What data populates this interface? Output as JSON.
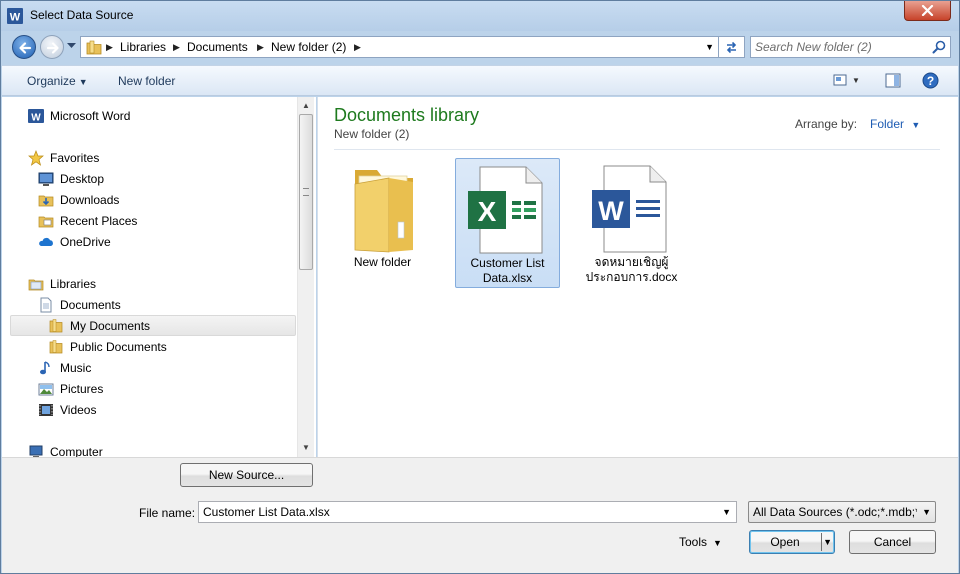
{
  "window": {
    "title": "Select Data Source",
    "app_icon": "word-icon",
    "close_icon": "close-icon"
  },
  "address_bar": {
    "crumbs": [
      "Libraries",
      "Documents",
      "New folder (2)"
    ],
    "search_placeholder": "Search New folder (2)"
  },
  "toolbar": {
    "organize_label": "Organize",
    "new_folder_label": "New folder"
  },
  "nav": {
    "app": "Microsoft Word",
    "favorites_header": "Favorites",
    "favorites": [
      "Desktop",
      "Downloads",
      "Recent Places",
      "OneDrive"
    ],
    "libraries_header": "Libraries",
    "documents": "Documents",
    "my_documents": "My Documents",
    "public_documents": "Public Documents",
    "music": "Music",
    "pictures": "Pictures",
    "videos": "Videos",
    "computer": "Computer"
  },
  "content": {
    "library_title": "Documents library",
    "library_subtitle": "New folder (2)",
    "arrange_label": "Arrange by:",
    "arrange_value": "Folder",
    "files": [
      {
        "name": "New folder",
        "type": "folder"
      },
      {
        "name_line1": "Customer List",
        "name_line2": "Data.xlsx",
        "type": "excel",
        "selected": true
      },
      {
        "name_line1": "จดหมายเชิญผู้",
        "name_line2": "ประกอบการ.docx",
        "type": "word"
      }
    ]
  },
  "footer": {
    "new_source_label": "New Source...",
    "file_name_label": "File name:",
    "file_name_value": "Customer List Data.xlsx",
    "filter_value": "All Data Sources (*.odc;*.mdb;*",
    "tools_label": "Tools",
    "open_label": "Open",
    "cancel_label": "Cancel"
  },
  "colors": {
    "library_title": "#1e7a1e",
    "link_blue": "#1e5cb3",
    "selection": "#cce0f7"
  }
}
